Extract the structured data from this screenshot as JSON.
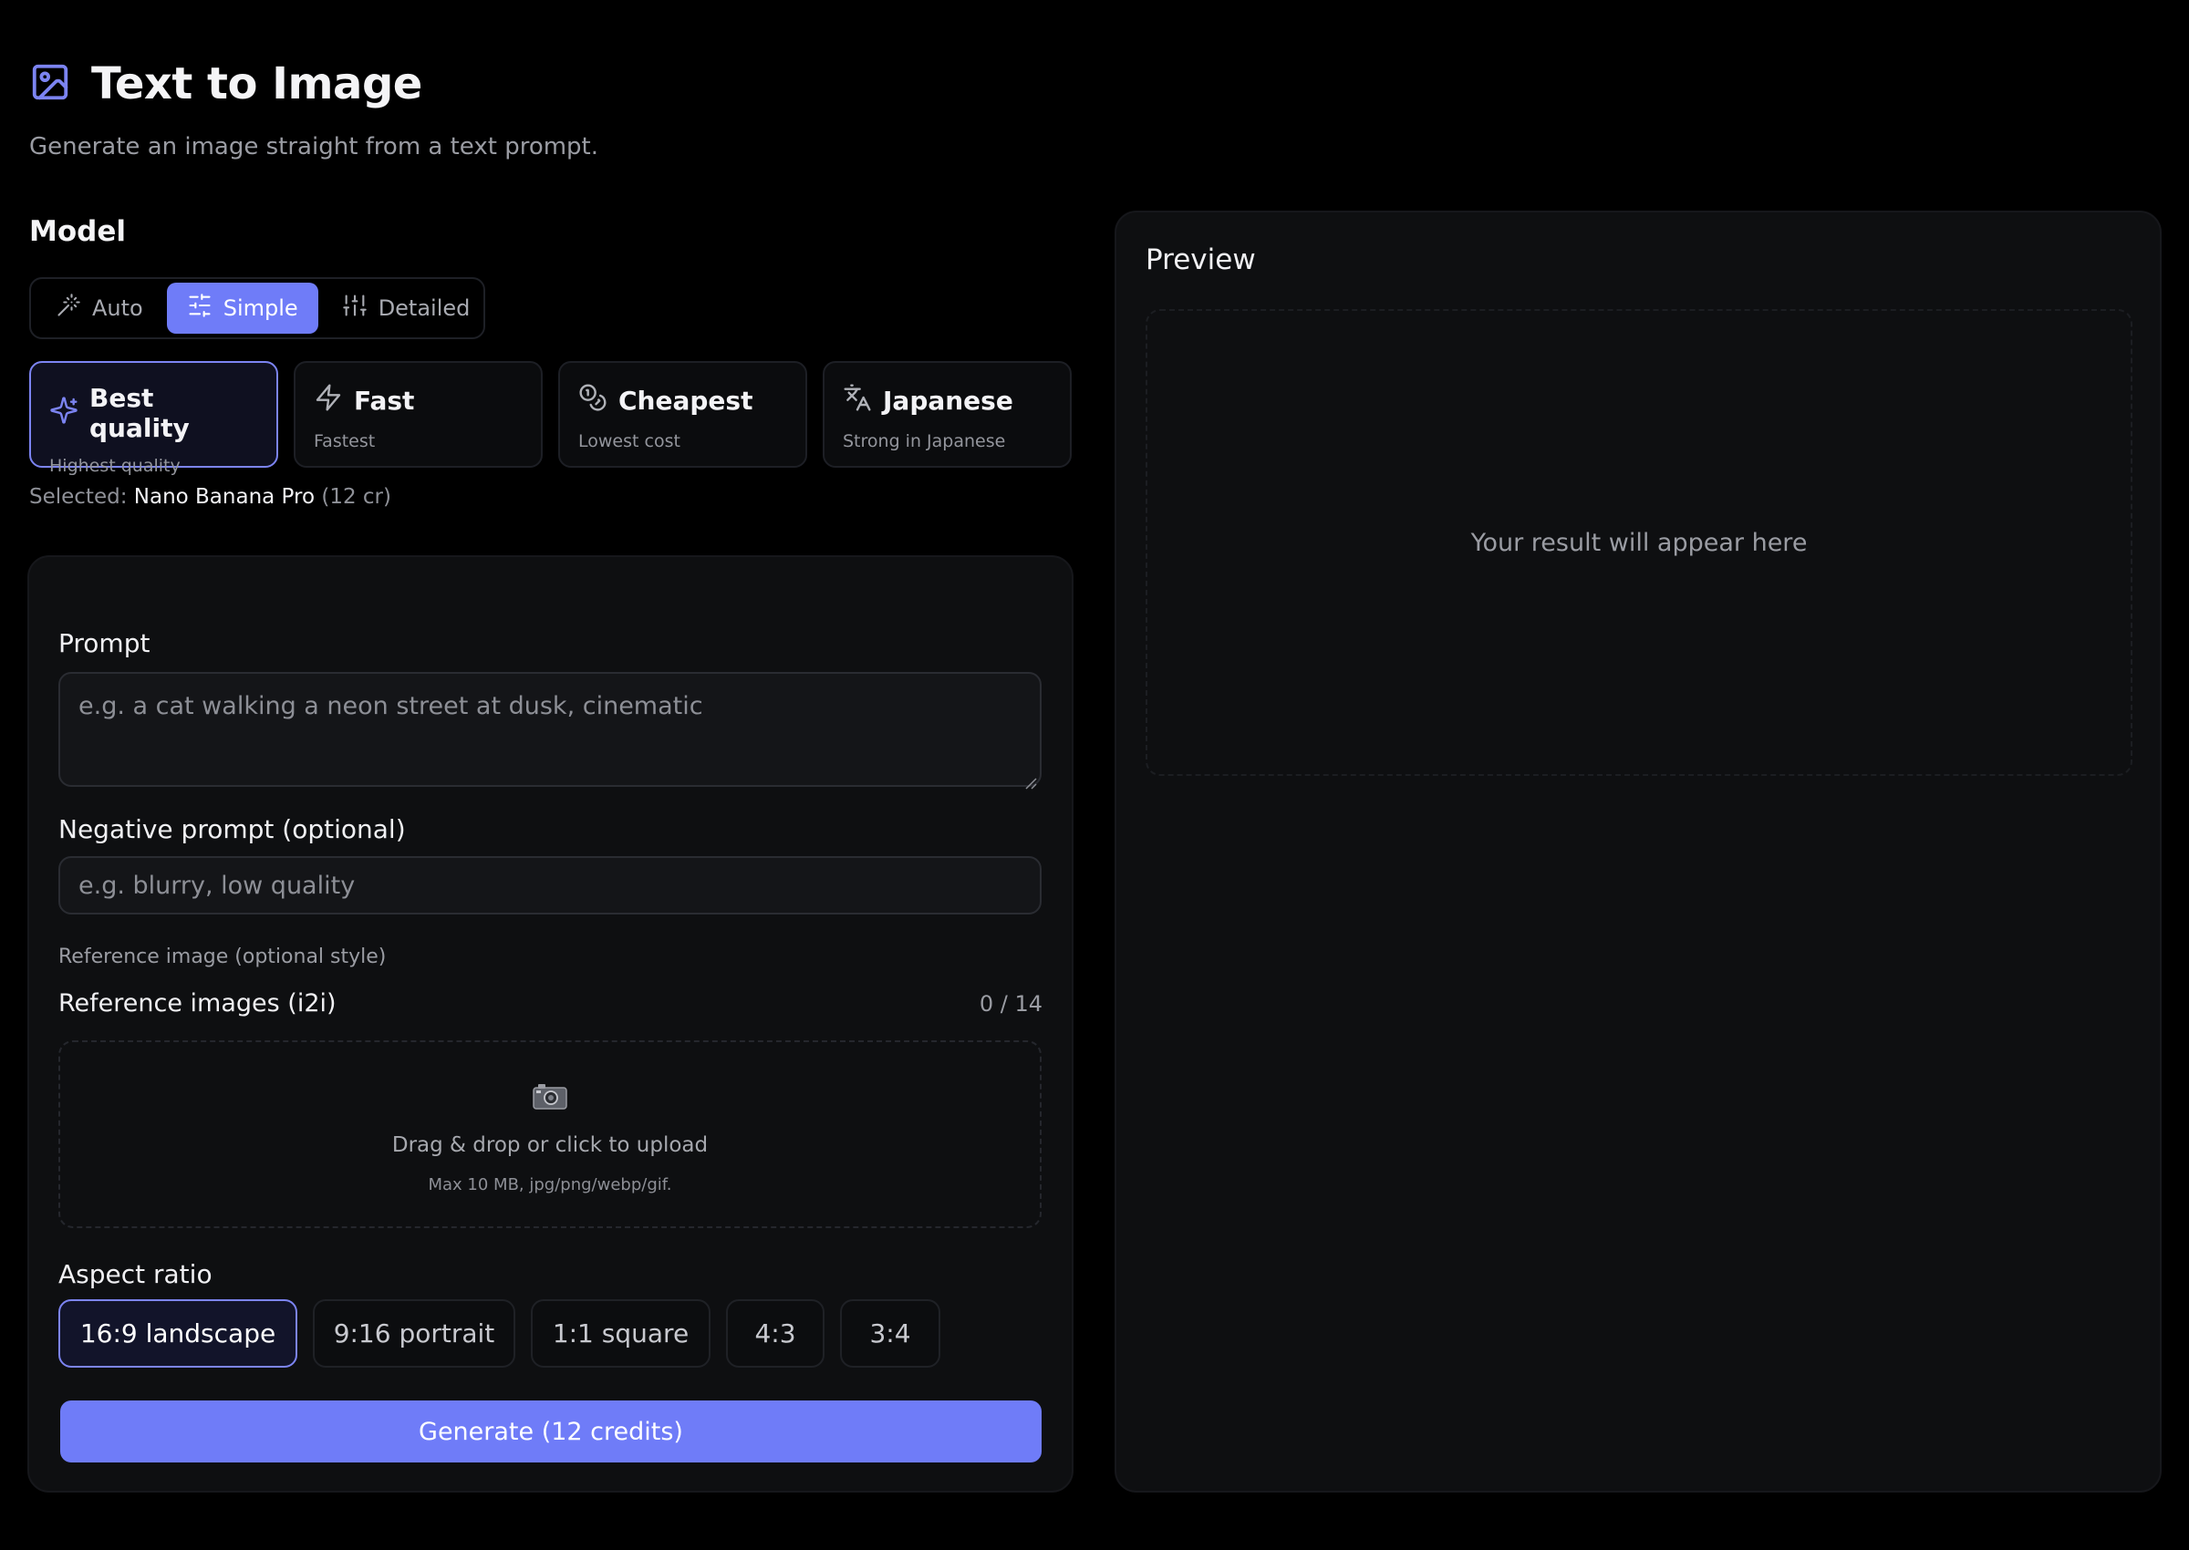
{
  "header": {
    "title": "Text to Image",
    "subtitle": "Generate an image straight from a text prompt.",
    "icon": "image-icon"
  },
  "model": {
    "label": "Model",
    "modes": [
      {
        "label": "Auto",
        "icon": "magic-wand-icon",
        "active": false
      },
      {
        "label": "Simple",
        "icon": "sliders-horizontal-icon",
        "active": true
      },
      {
        "label": "Detailed",
        "icon": "sliders-vertical-icon",
        "active": false
      }
    ],
    "quality_options": [
      {
        "label": "Best quality",
        "sub": "Highest quality",
        "icon": "sparkles-icon",
        "active": true
      },
      {
        "label": "Fast",
        "sub": "Fastest",
        "icon": "lightning-icon",
        "active": false
      },
      {
        "label": "Cheapest",
        "sub": "Lowest cost",
        "icon": "coins-icon",
        "active": false
      },
      {
        "label": "Japanese",
        "sub": "Strong in Japanese",
        "icon": "translate-icon",
        "active": false
      }
    ],
    "selected_prefix": "Selected:",
    "selected_name": "Nano Banana Pro",
    "selected_cost": "(12 cr)"
  },
  "form": {
    "prompt_label": "Prompt",
    "prompt_placeholder": "e.g. a cat walking a neon street at dusk, cinematic",
    "negative_label": "Negative prompt (optional)",
    "negative_placeholder": "e.g. blurry, low quality",
    "reference_small_label": "Reference image (optional style)",
    "reference_label": "Reference images (i2i)",
    "reference_count": "0 / 14",
    "dropzone_main": "Drag & drop or click to upload",
    "dropzone_sub": "Max 10 MB, jpg/png/webp/gif.",
    "aspect_label": "Aspect ratio",
    "aspect_options": [
      {
        "label": "16:9 landscape",
        "active": true
      },
      {
        "label": "9:16 portrait",
        "active": false
      },
      {
        "label": "1:1 square",
        "active": false
      },
      {
        "label": "4:3",
        "active": false
      },
      {
        "label": "3:4",
        "active": false
      }
    ],
    "generate_label": "Generate (12 credits)"
  },
  "preview": {
    "title": "Preview",
    "placeholder": "Your result will appear here"
  },
  "colors": {
    "accent": "#6f7cf8",
    "background": "#000000",
    "panel": "#0e0f11"
  }
}
